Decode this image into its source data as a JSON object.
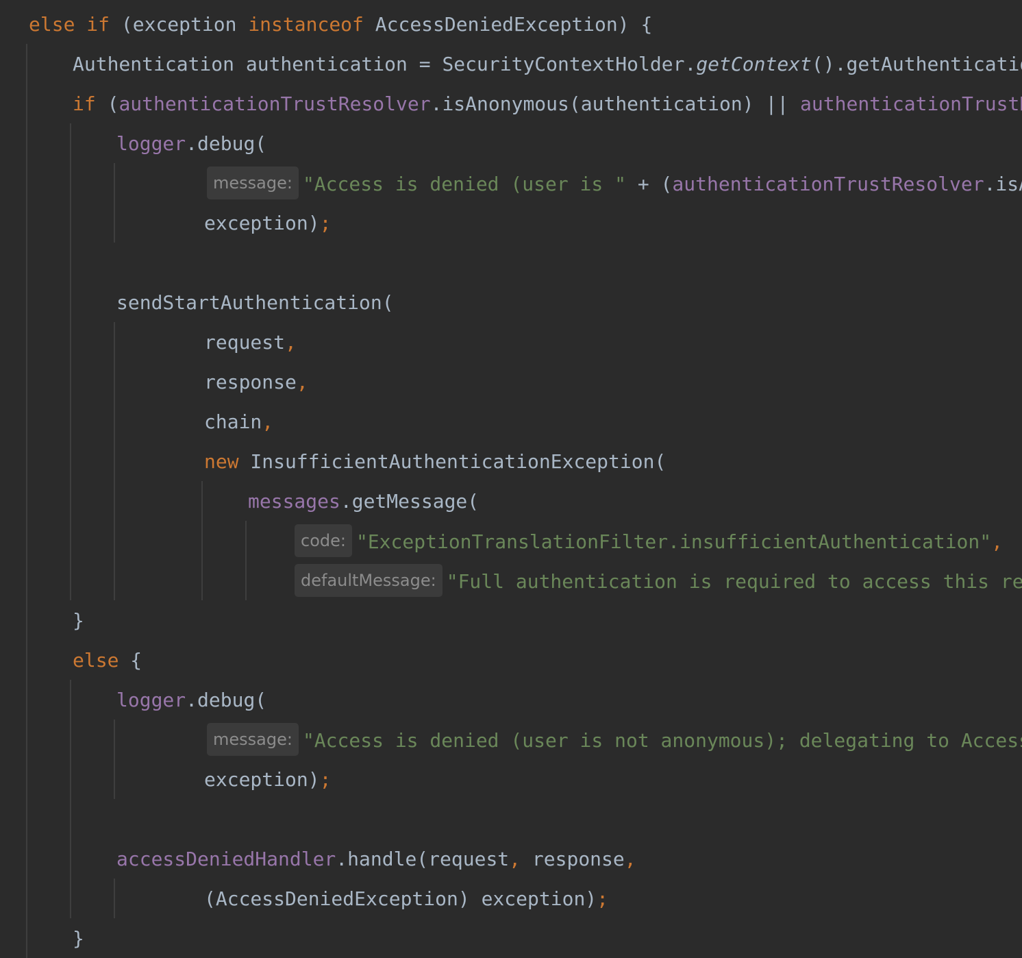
{
  "editor": {
    "theme": {
      "background": "#2b2b2b",
      "keyword": "#cc7832",
      "field": "#9876aa",
      "string": "#6a8759",
      "text": "#a9b7c6",
      "hint_bg": "#3b3b3b",
      "hint_text": "#8c8c8c"
    },
    "lines": {
      "l1": {
        "kw_else": "else",
        "kw_if": "if",
        "t1": " (exception ",
        "kw_instanceof": "instanceof",
        "t2": " AccessDeniedException) {"
      },
      "l2": {
        "t1": "Authentication authentication = SecurityContextHolder.",
        "italic": "getContext",
        "t2": "().getAuthentication()",
        "semi": ";"
      },
      "l3": {
        "kw_if": "if",
        "t1": " (",
        "f1": "authenticationTrustResolver",
        "t2": ".isAnonymous(authentication) || ",
        "f2": "authenticationTrustResolver.isRememberMe(authentication)) {"
      },
      "l4": {
        "f1": "logger",
        "t1": ".debug("
      },
      "l5": {
        "hint": "message:",
        "s1": "\"Access is denied (user is \"",
        "t1": " + (",
        "f1": "authenticationTrustResolver",
        "t2": ".isAnonymous(authentication) ? \"anonymous\" : \"not fully authenticated\") + \"); redirecting to authentication entry point\","
      },
      "l6": {
        "t1": "exception)",
        "semi": ";"
      },
      "l7": {
        "t1": "sendStartAuthentication("
      },
      "l8": {
        "t1": "request",
        "comma": ","
      },
      "l9": {
        "t1": "response",
        "comma": ","
      },
      "l10": {
        "t1": "chain",
        "comma": ","
      },
      "l11": {
        "kw_new": "new",
        "t1": " InsufficientAuthenticationException("
      },
      "l12": {
        "f1": "messages",
        "t1": ".getMessage("
      },
      "l13": {
        "hint": "code:",
        "s1": "\"ExceptionTranslationFilter.insufficientAuthentication\"",
        "comma": ","
      },
      "l14": {
        "hint": "defaultMessage:",
        "s1": "\"Full authentication is required to access this resource\""
      },
      "l15": {
        "t1": "}"
      },
      "l16": {
        "kw_else": "else",
        "t1": " {"
      },
      "l17": {
        "f1": "logger",
        "t1": ".debug("
      },
      "l18": {
        "hint": "message:",
        "s1": "\"Access is denied (user is not anonymous); delegating to AccessDeniedHandler\"",
        "comma": ","
      },
      "l19": {
        "t1": "exception)",
        "semi": ";"
      },
      "l20": {
        "f1": "accessDeniedHandler",
        "t1": ".handle(request",
        "c1": ",",
        "t2": " response",
        "c2": ","
      },
      "l21": {
        "t1": "(AccessDeniedException) exception)",
        "semi": ";"
      },
      "l22": {
        "t1": "}"
      }
    }
  }
}
